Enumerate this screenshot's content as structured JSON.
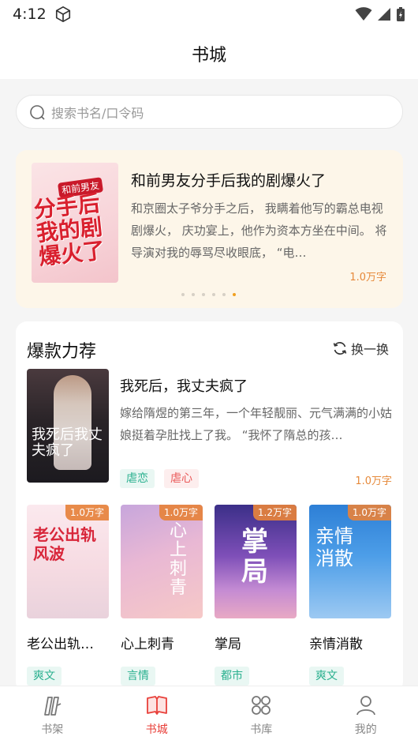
{
  "status": {
    "time": "4:12"
  },
  "header": {
    "title": "书城"
  },
  "search": {
    "placeholder": "搜索书名/口令码"
  },
  "banner": {
    "title": "和前男友分手后我的剧爆火了",
    "description": "和京圈太子爷分手之后， 我瞒着他写的霸总电视剧爆火， 庆功宴上，他作为资本方坐在中间。 将导演对我的辱骂尽收眼底， “电…",
    "words": "1.0万字",
    "cover_text": "分手后我的剧爆火了",
    "cover_tag": "和前男友",
    "dot_count": 6,
    "active_dot": 5
  },
  "section": {
    "title": "爆款力荐",
    "refresh_label": "换一换",
    "featured": {
      "title": "我死后，我丈夫疯了",
      "description": "嫁给隋煜的第三年，一个年轻靓丽、元气满满的小姑娘挺着孕肚找上了我。 “我怀了隋总的孩…",
      "tags": [
        "虐恋",
        "虐心"
      ],
      "words": "1.0万字",
      "cover_text": "我死后我丈夫疯了"
    },
    "grid": [
      {
        "title": "老公出轨…",
        "words": "1.0万字",
        "tag": "爽文",
        "cover_text": "老公出轨风波"
      },
      {
        "title": "心上刺青",
        "words": "1.0万字",
        "tag": "言情",
        "cover_text": "心上刺青"
      },
      {
        "title": "掌局",
        "words": "1.2万字",
        "tag": "都市",
        "cover_text": "掌局"
      },
      {
        "title": "亲情消散",
        "words": "1.0万字",
        "tag": "爽文",
        "cover_text": "亲情消散"
      }
    ]
  },
  "tabs": [
    {
      "label": "书架",
      "icon": "bookshelf-icon",
      "active": false
    },
    {
      "label": "书城",
      "icon": "book-open-icon",
      "active": true
    },
    {
      "label": "书库",
      "icon": "grid-icon",
      "active": false
    },
    {
      "label": "我的",
      "icon": "user-icon",
      "active": false
    }
  ],
  "colors": {
    "accent": "#e8403a",
    "orange": "#e6893a",
    "green_tag": "#2ab08f",
    "pink_tag": "#ea5a5a",
    "banner_bg": "#fdf6e9"
  }
}
